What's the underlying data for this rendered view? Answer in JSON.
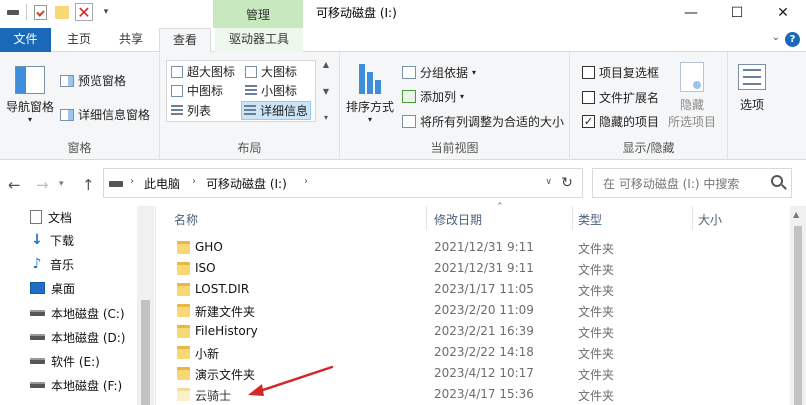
{
  "titlebar": {
    "manage_tab": "管理",
    "window_title": "可移动磁盘 (I:)",
    "minimize": "—",
    "maximize": "☐",
    "close": "✕"
  },
  "tabs": {
    "file": "文件",
    "home": "主页",
    "share": "共享",
    "view": "查看",
    "drive_tools": "驱动器工具"
  },
  "ribbon": {
    "panes": {
      "label": "窗格",
      "nav_pane": "导航窗格",
      "preview_pane": "预览窗格",
      "details_pane": "详细信息窗格"
    },
    "layout": {
      "label": "布局",
      "items": [
        "超大图标",
        "大图标",
        "中图标",
        "小图标",
        "列表",
        "详细信息"
      ]
    },
    "current_view": {
      "label": "当前视图",
      "sort_by": "排序方式",
      "group_by": "分组依据",
      "add_column": "添加列",
      "fit_columns": "将所有列调整为合适的大小"
    },
    "show_hide": {
      "label": "显示/隐藏",
      "item_checkboxes": "项目复选框",
      "file_extensions": "文件扩展名",
      "hidden_items": "隐藏的项目",
      "hide_line1": "隐藏",
      "hide_line2": "所选项目"
    },
    "options": "选项"
  },
  "address": {
    "crumbs": [
      "此电脑",
      "可移动磁盘 (I:)"
    ],
    "search_placeholder": "在 可移动磁盘 (I:) 中搜索"
  },
  "nav_items": [
    {
      "label": "文档",
      "icon": "document-icon"
    },
    {
      "label": "下载",
      "icon": "download-icon"
    },
    {
      "label": "音乐",
      "icon": "music-icon"
    },
    {
      "label": "桌面",
      "icon": "desktop-icon"
    },
    {
      "label": "本地磁盘 (C:)",
      "icon": "drive-icon"
    },
    {
      "label": "本地磁盘 (D:)",
      "icon": "drive-icon"
    },
    {
      "label": "软件 (E:)",
      "icon": "drive-icon"
    },
    {
      "label": "本地磁盘 (F:)",
      "icon": "drive-icon"
    }
  ],
  "columns": {
    "name": "名称",
    "modified": "修改日期",
    "type": "类型",
    "size": "大小"
  },
  "files": [
    {
      "name": "GHO",
      "modified": "2021/12/31 9:11",
      "type": "文件夹"
    },
    {
      "name": "ISO",
      "modified": "2021/12/31 9:11",
      "type": "文件夹"
    },
    {
      "name": "LOST.DIR",
      "modified": "2023/1/17 11:05",
      "type": "文件夹"
    },
    {
      "name": "新建文件夹",
      "modified": "2023/2/20 11:09",
      "type": "文件夹"
    },
    {
      "name": "FileHistory",
      "modified": "2023/2/21 16:39",
      "type": "文件夹"
    },
    {
      "name": "小新",
      "modified": "2023/2/22 14:18",
      "type": "文件夹"
    },
    {
      "name": "演示文件夹",
      "modified": "2023/4/12 10:17",
      "type": "文件夹"
    },
    {
      "name": "云骑士",
      "modified": "2023/4/17 15:36",
      "type": "文件夹"
    }
  ],
  "colors": {
    "accent": "#1a68b8",
    "manage_tab": "#c8e9bf",
    "folder": "#f8d775",
    "annotation_arrow": "#d42828"
  }
}
